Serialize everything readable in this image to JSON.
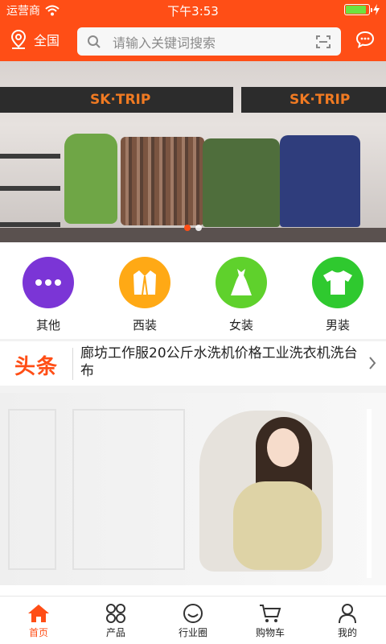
{
  "status": {
    "carrier": "运营商",
    "time": "下午3:53",
    "battery_level": 0.9
  },
  "nav": {
    "location_label": "全国",
    "search_placeholder": "请输入关键词搜索"
  },
  "banner": {
    "brand_text": "SK·TRIP",
    "active_slide": 1,
    "slide_count": 2
  },
  "categories": [
    {
      "label": "其他",
      "color": "#7b35d6",
      "icon": "more-dots-icon"
    },
    {
      "label": "西装",
      "color": "#ffa915",
      "icon": "suit-icon"
    },
    {
      "label": "女装",
      "color": "#5fd12c",
      "icon": "dress-icon"
    },
    {
      "label": "男装",
      "color": "#2fc92f",
      "icon": "tshirt-icon"
    }
  ],
  "news": {
    "tag": "头条",
    "headline": "廊坊工作服20公斤水洗机价格工业洗衣机洗台布"
  },
  "tabs": [
    {
      "label": "首页",
      "icon": "home-icon",
      "active": true
    },
    {
      "label": "产品",
      "icon": "grid-icon",
      "active": false
    },
    {
      "label": "行业圈",
      "icon": "smile-icon",
      "active": false
    },
    {
      "label": "购物车",
      "icon": "cart-icon",
      "active": false
    },
    {
      "label": "我的",
      "icon": "user-icon",
      "active": false
    }
  ],
  "colors": {
    "accent": "#ff4e16",
    "battery": "#6ee23f"
  }
}
